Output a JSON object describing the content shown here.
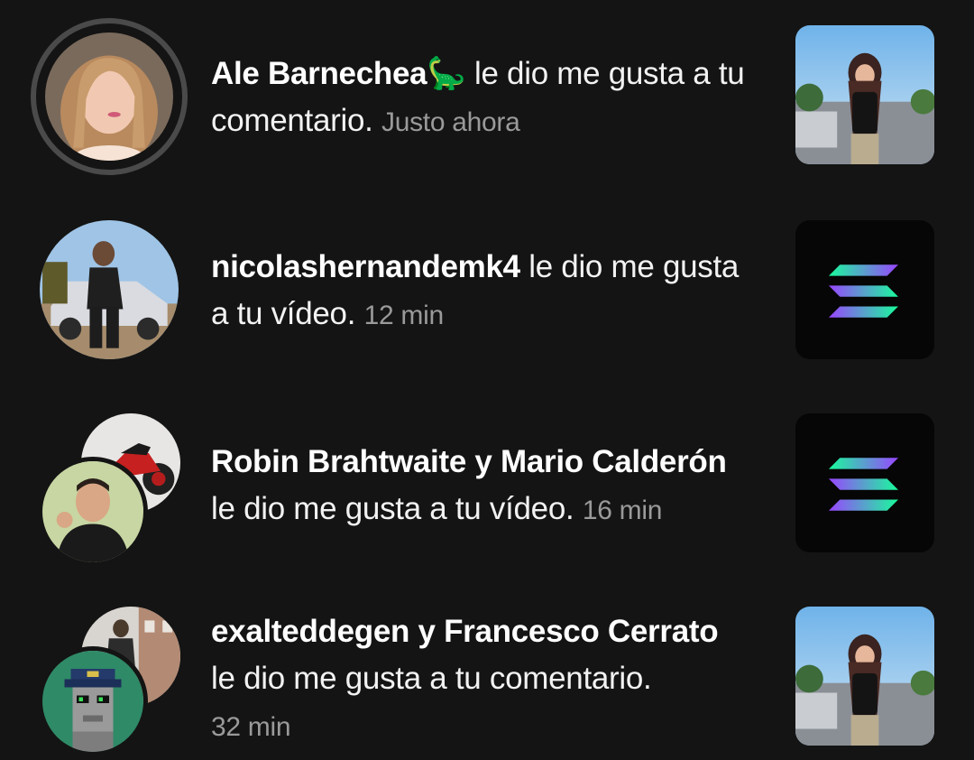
{
  "notifications": [
    {
      "user": "Ale Barnechea",
      "emoji": "🦕",
      "action": " le dio me gusta a tu comentario.",
      "time": "Justo ahora",
      "avatar_icon": "profile-photo-woman",
      "thumbnail_icon": "video-thumbnail-girl-photo"
    },
    {
      "user": "nicolashernandemk4",
      "action": " le dio me gusta a tu vídeo.",
      "time": "12 min",
      "avatar_icon": "profile-photo-man-car",
      "thumbnail_icon": "solana-logo"
    },
    {
      "user": "Robin Brahtwaite y Mario Calderón",
      "action": "le dio me gusta a tu vídeo.",
      "time": "16 min",
      "avatar_icon": "profile-photo-stack",
      "thumbnail_icon": "solana-logo"
    },
    {
      "user": "exalteddegen y Francesco Cerrato",
      "action": "le dio me gusta a tu comentario.",
      "time": "32 min",
      "avatar_icon": "profile-photo-stack",
      "thumbnail_icon": "video-thumbnail-girl-photo"
    }
  ],
  "colors": {
    "background": "#141414",
    "time_text": "#9a9a9a",
    "unread_ring": "#4a4a4a"
  }
}
